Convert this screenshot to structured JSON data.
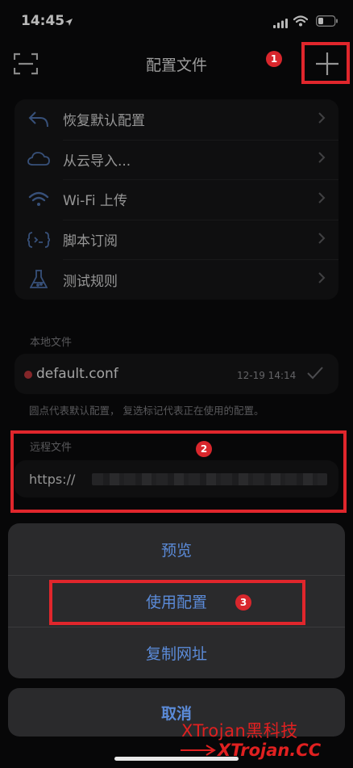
{
  "status": {
    "time": "14:45"
  },
  "nav": {
    "title": "配置文件"
  },
  "menu": {
    "items": [
      {
        "label": "恢复默认配置",
        "icon": "undo-arrow-icon"
      },
      {
        "label": "从云导入...",
        "icon": "cloud-icon"
      },
      {
        "label": "Wi-Fi 上传",
        "icon": "wifi-icon"
      },
      {
        "label": "脚本订阅",
        "icon": "script-braces-icon"
      },
      {
        "label": "测试规则",
        "icon": "flask-icon"
      }
    ]
  },
  "local": {
    "section_label": "本地文件",
    "file_name": "default.conf",
    "date": "12-19 14:14",
    "hint": "圆点代表默认配置， 复选标记代表正在使用的配置。"
  },
  "remote": {
    "section_label": "远程文件",
    "url": "https://"
  },
  "sheet": {
    "preview": "预览",
    "use_config": "使用配置",
    "copy_url": "复制网址",
    "cancel": "取消"
  },
  "annotations": {
    "badge1": "1",
    "badge2": "2",
    "badge3": "3"
  },
  "watermark": {
    "line1": "XTrojan黑科技",
    "line2": "XTrojan.CC"
  },
  "colors": {
    "accent": "#5b8bd9",
    "highlight": "#e0262c",
    "dot": "#b8353a"
  }
}
